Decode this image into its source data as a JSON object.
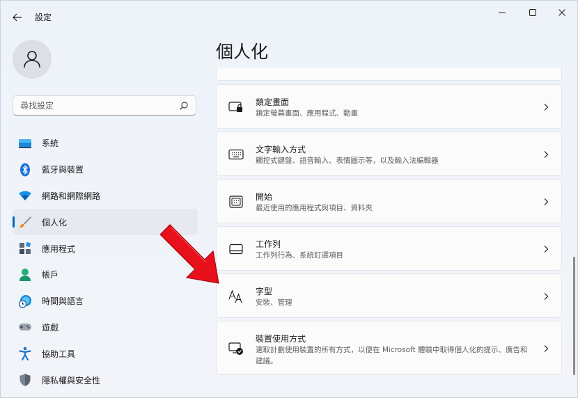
{
  "app": {
    "title": "設定"
  },
  "search": {
    "placeholder": "尋找設定"
  },
  "nav": {
    "items": [
      {
        "label": "系統",
        "icon": "monitor-icon"
      },
      {
        "label": "藍牙與裝置",
        "icon": "bluetooth-icon"
      },
      {
        "label": "網路和網際網路",
        "icon": "wifi-icon"
      },
      {
        "label": "個人化",
        "icon": "brush-icon",
        "active": true
      },
      {
        "label": "應用程式",
        "icon": "apps-icon"
      },
      {
        "label": "帳戶",
        "icon": "account-icon"
      },
      {
        "label": "時間與語言",
        "icon": "clock-globe-icon"
      },
      {
        "label": "遊戲",
        "icon": "gamepad-icon"
      },
      {
        "label": "協助工具",
        "icon": "accessibility-icon"
      },
      {
        "label": "隱私權與安全性",
        "icon": "shield-icon"
      }
    ]
  },
  "main": {
    "title": "個人化",
    "cards": [
      {
        "title": "鎖定畫面",
        "desc": "鎖定螢幕畫面、應用程式、動畫",
        "icon": "lock-screen-icon"
      },
      {
        "title": "文字輸入方式",
        "desc": "觸控式鍵盤、語音輸入、表情圖示等，以及輸入法編輯器",
        "icon": "keyboard-icon"
      },
      {
        "title": "開始",
        "desc": "最近使用的應用程式與項目、資料夾",
        "icon": "start-menu-icon"
      },
      {
        "title": "工作列",
        "desc": "工作列行為、系統釘選項目",
        "icon": "taskbar-icon"
      },
      {
        "title": "字型",
        "desc": "安裝、管理",
        "icon": "fonts-icon"
      },
      {
        "title": "裝置使用方式",
        "desc": "選取計劃使用裝置的所有方式，以便在 Microsoft 體驗中取得個人化的提示、廣告和建議。",
        "icon": "device-usage-icon"
      }
    ]
  },
  "colors": {
    "accent": "#0067c0",
    "annotation_arrow": "#e8101a"
  }
}
